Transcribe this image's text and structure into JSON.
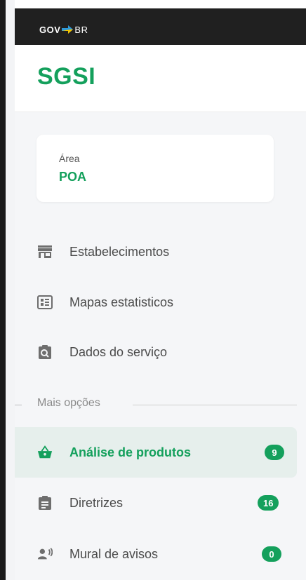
{
  "topbar": {
    "gov_text": "GOV",
    "br_text": "BR"
  },
  "app": {
    "title": "SGSI"
  },
  "area": {
    "label": "Área",
    "value": "POA"
  },
  "nav": [
    {
      "label": "Estabelecimentos",
      "icon": "storefront-icon"
    },
    {
      "label": "Mapas estatisticos",
      "icon": "map-dashboard-icon"
    },
    {
      "label": "Dados do serviço",
      "icon": "clipboard-search-icon"
    }
  ],
  "section": {
    "label": "Mais opções"
  },
  "more_nav": [
    {
      "label": "Análise de produtos",
      "icon": "basket-icon",
      "badge": "9",
      "active": true
    },
    {
      "label": "Diretrizes",
      "icon": "clipboard-list-icon",
      "badge": "16",
      "active": false
    },
    {
      "label": "Mural de avisos",
      "icon": "announcement-icon",
      "badge": "0",
      "active": false
    }
  ],
  "colors": {
    "brand": "#14a05c",
    "topbar": "#202020",
    "active_bg": "#e6efec",
    "icon_gray": "#6e6e6e"
  }
}
